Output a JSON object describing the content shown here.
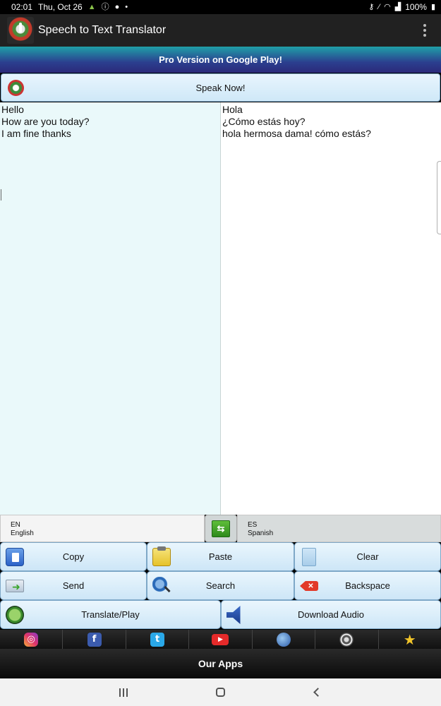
{
  "status_bar": {
    "time": "02:01",
    "date": "Thu, Oct 26",
    "battery": "100%",
    "icons": [
      "android-icon",
      "info-icon",
      "bulb-icon",
      "dot-icon",
      "vpn-key-icon",
      "mute-icon",
      "wifi-icon",
      "signal-icon",
      "battery-icon"
    ]
  },
  "app_bar": {
    "title": "Speech to Text Translator",
    "logo_icon": "mic-logo-icon",
    "menu_icon": "overflow-menu-icon"
  },
  "promo": {
    "label": "Pro Version on Google Play!"
  },
  "speak": {
    "label": "Speak Now!",
    "icon": "mic-icon"
  },
  "source_text": "Hello\nHow are you today?\nI am fine thanks",
  "target_text": "Hola\n¿Cómo estás hoy?\nhola hermosa dama! cómo estás?",
  "languages": {
    "source": {
      "code": "EN",
      "name": "English"
    },
    "target": {
      "code": "ES",
      "name": "Spanish"
    },
    "swap_icon": "swap-icon"
  },
  "buttons": {
    "copy": "Copy",
    "paste": "Paste",
    "clear": "Clear",
    "send": "Send",
    "search": "Search",
    "backspace": "Backspace",
    "translate_play": "Translate/Play",
    "download_audio": "Download Audio"
  },
  "social": [
    "instagram",
    "facebook",
    "twitter",
    "youtube",
    "globe",
    "wheel",
    "star"
  ],
  "our_apps": {
    "label": "Our Apps"
  },
  "colors": {
    "app_bar": "#212121",
    "promo_top": "#1fa0a8",
    "promo_bottom": "#2b2a7a",
    "button_bg": "#cde6f7",
    "source_pane": "#eaf9fa"
  }
}
